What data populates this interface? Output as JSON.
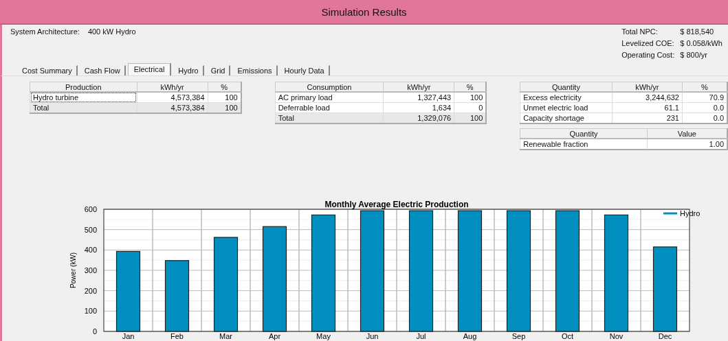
{
  "window": {
    "title": "Simulation Results"
  },
  "system_architecture": {
    "label": "System Architecture:",
    "value": "400 kW Hydro"
  },
  "summary": [
    {
      "label": "Total NPC:",
      "value": "$ 818,540"
    },
    {
      "label": "Levelized COE:",
      "value": "$ 0.058/kWh"
    },
    {
      "label": "Operating Cost:",
      "value": "$ 800/yr"
    }
  ],
  "tabs": [
    {
      "label": "Cost Summary",
      "selected": false
    },
    {
      "label": "Cash Flow",
      "selected": false
    },
    {
      "label": "Electrical",
      "selected": true
    },
    {
      "label": "Hydro",
      "selected": false
    },
    {
      "label": "Grid",
      "selected": false
    },
    {
      "label": "Emissions",
      "selected": false
    },
    {
      "label": "Hourly Data",
      "selected": false
    }
  ],
  "tables": [
    {
      "columns": [
        "Production",
        "kWh/yr",
        "%"
      ],
      "rows": [
        {
          "kind": "data",
          "selected": true,
          "cells": [
            "Hydro turbine",
            "4,573,384",
            "100"
          ]
        },
        {
          "kind": "total",
          "selected": false,
          "cells": [
            "Total",
            "4,573,384",
            "100"
          ]
        }
      ]
    },
    {
      "columns": [
        "Consumption",
        "kWh/yr",
        "%"
      ],
      "rows": [
        {
          "kind": "data",
          "selected": false,
          "cells": [
            "AC primary load",
            "1,327,443",
            "100"
          ]
        },
        {
          "kind": "data",
          "selected": false,
          "cells": [
            "Deferrable load",
            "1,634",
            "0"
          ]
        },
        {
          "kind": "total",
          "selected": false,
          "cells": [
            "Total",
            "1,329,076",
            "100"
          ]
        }
      ]
    },
    {
      "columns": [
        "Quantity",
        "kWh/yr",
        "%"
      ],
      "rows": [
        {
          "kind": "data",
          "selected": false,
          "cells": [
            "Excess electricity",
            "3,244,632",
            "70.9"
          ]
        },
        {
          "kind": "data",
          "selected": false,
          "cells": [
            "Unmet electric load",
            "61.1",
            "0.0"
          ]
        },
        {
          "kind": "data",
          "selected": false,
          "cells": [
            "Capacity shortage",
            "231",
            "0.0"
          ]
        }
      ]
    },
    {
      "columns": [
        "Quantity",
        "Value"
      ],
      "rows": [
        {
          "kind": "data",
          "selected": false,
          "cells": [
            "Renewable fraction",
            "1.00"
          ]
        }
      ]
    }
  ],
  "chart": {
    "chart_data": {
      "type": "bar",
      "title": "Monthly Average Electric Production",
      "ylabel": "Power (kW)",
      "categories": [
        "Jan",
        "Feb",
        "Mar",
        "Apr",
        "May",
        "Jun",
        "Jul",
        "Aug",
        "Sep",
        "Oct",
        "Nov",
        "Dec"
      ],
      "series": [
        {
          "name": "Hydro",
          "color": "#008fbf",
          "values": [
            393,
            348,
            462,
            515,
            572,
            593,
            593,
            593,
            593,
            593,
            572,
            415
          ]
        }
      ],
      "grid": true,
      "ylim": [
        0,
        600
      ],
      "yticks": [
        0,
        100,
        200,
        300,
        400,
        500,
        600
      ]
    }
  }
}
